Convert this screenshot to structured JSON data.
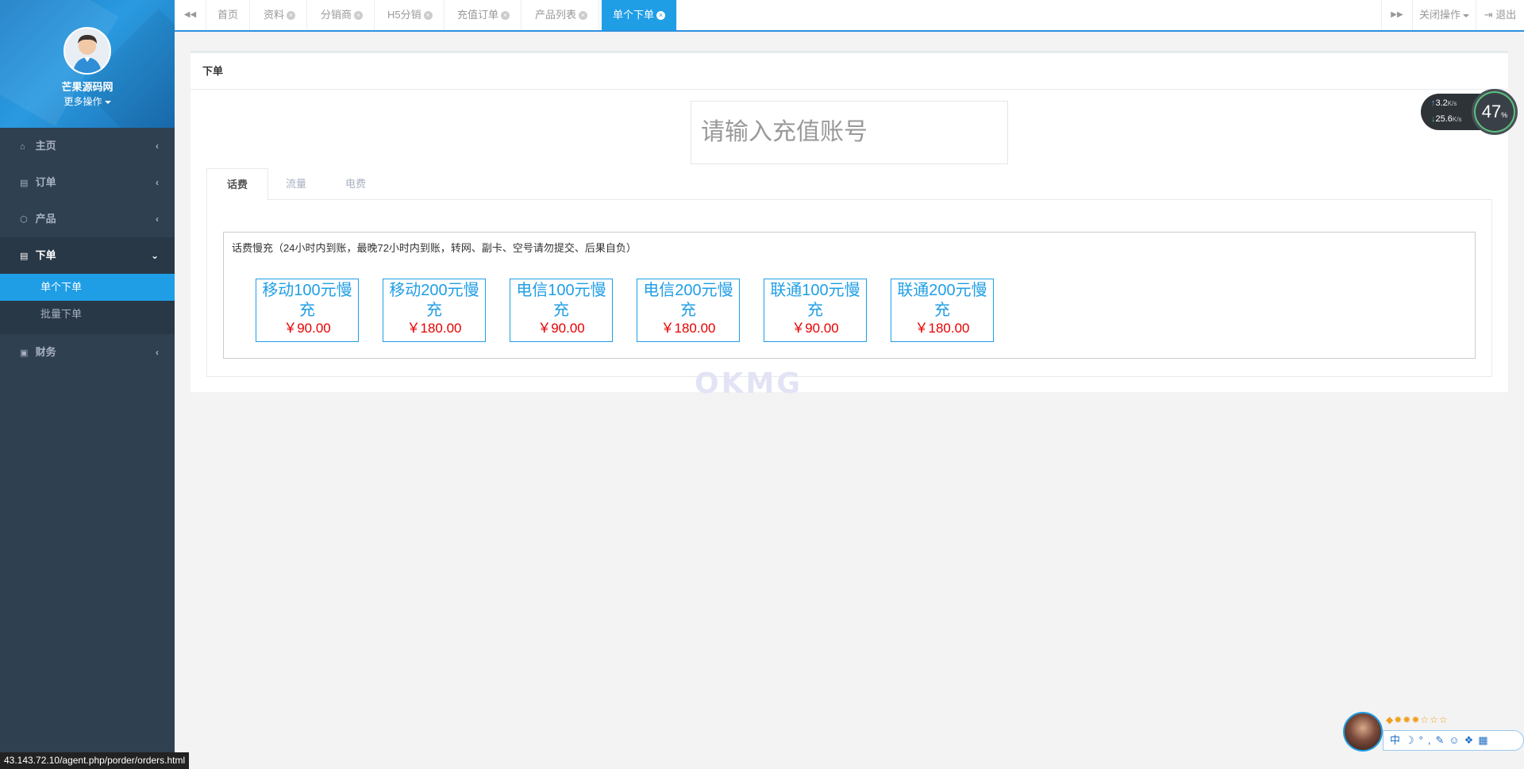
{
  "profile": {
    "name": "芒果源码网",
    "more": "更多操作"
  },
  "sidebar": {
    "items": [
      {
        "label": "主页",
        "icon": "home-icon",
        "glyph": "⌂",
        "arrow": "‹"
      },
      {
        "label": "订单",
        "icon": "file-icon",
        "glyph": "▤",
        "arrow": "‹"
      },
      {
        "label": "产品",
        "icon": "cube-icon",
        "glyph": "⬡",
        "arrow": "‹"
      },
      {
        "label": "下单",
        "icon": "file-icon",
        "glyph": "▤",
        "arrow": "⌄"
      },
      {
        "label": "财务",
        "icon": "money-icon",
        "glyph": "▣",
        "arrow": "‹"
      }
    ],
    "subitems": [
      "单个下单",
      "批量下单"
    ]
  },
  "topbar": {
    "prev": "◀◀",
    "next": "▶▶",
    "tabs": [
      {
        "label": "首页",
        "closable": false
      },
      {
        "label": "资料",
        "closable": true
      },
      {
        "label": "分销商",
        "closable": true
      },
      {
        "label": "H5分销",
        "closable": true
      },
      {
        "label": "充值订单",
        "closable": true
      },
      {
        "label": "产品列表",
        "closable": true
      },
      {
        "label": "单个下单",
        "closable": true
      }
    ],
    "close_ops": "关闭操作",
    "logout": "退出",
    "accent": "#1f9ee6"
  },
  "main": {
    "panel_title": "下单",
    "account_placeholder": "请输入充值账号",
    "tabs": [
      "话费",
      "流量",
      "电费"
    ],
    "notice": "话费慢充（24小时内到账，最晚72小时内到账，转网、副卡、空号请勿提交、后果自负）",
    "products": [
      {
        "name": "移动100元慢充",
        "price": "￥90.00"
      },
      {
        "name": "移动200元慢充",
        "price": "￥180.00"
      },
      {
        "name": "电信100元慢充",
        "price": "￥90.00"
      },
      {
        "name": "电信200元慢充",
        "price": "￥180.00"
      },
      {
        "name": "联通100元慢充",
        "price": "￥90.00"
      },
      {
        "name": "联通200元慢充",
        "price": "￥180.00"
      }
    ]
  },
  "watermark": "OKMG",
  "net": {
    "up": "3.2",
    "down": "25.6",
    "unit": "K/s",
    "percent": "47",
    "percent_unit": "%"
  },
  "ime": {
    "stars": "◆✹✹✹☆☆☆",
    "toolbar": "中☽°,✎☺❖▦"
  },
  "status_url": "43.143.72.10/agent.php/porder/orders.html"
}
